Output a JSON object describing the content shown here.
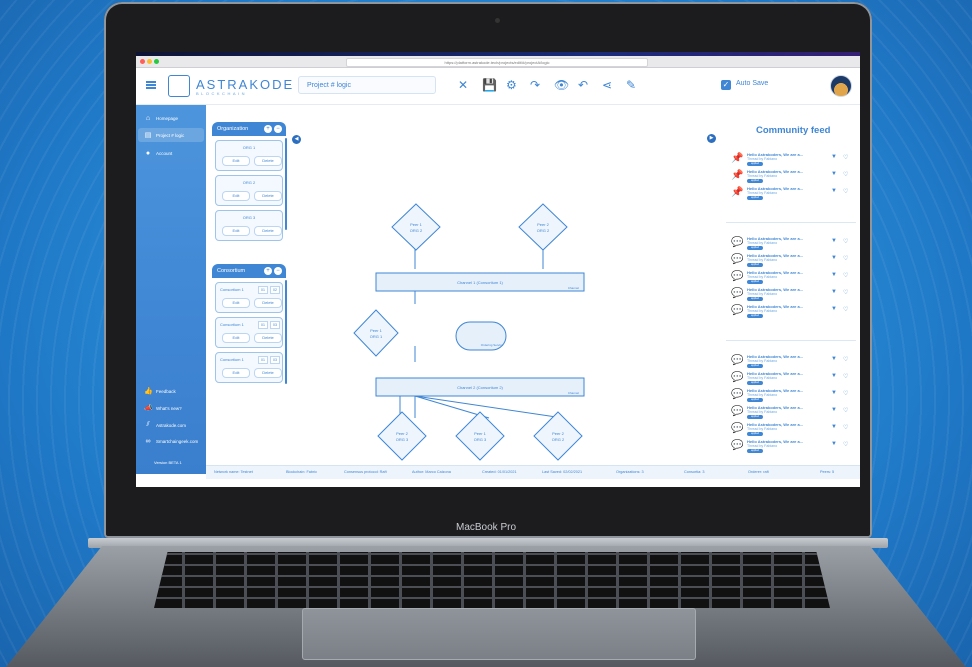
{
  "browser": {
    "url": "https://platform.astrakode.tech/projects/edit/#/projectA/logic"
  },
  "header": {
    "logo_text": "ASTRAKODE",
    "logo_sub": "BLOCKCHAIN",
    "project_name": "Project # logic",
    "autosave_label": "Auto Save",
    "autosave_check": "✓",
    "tools": [
      "✕",
      "💾",
      "⚙",
      "↷",
      "👁",
      "↶",
      "⋖",
      "✎"
    ]
  },
  "sidebar": {
    "items": [
      {
        "icon": "⌂",
        "label": "Homepage"
      },
      {
        "icon": "▤",
        "label": "Project # logic"
      },
      {
        "icon": "●",
        "label": "Account"
      }
    ],
    "bottom_items": [
      {
        "icon": "👍",
        "label": "Feedback"
      },
      {
        "icon": "📣",
        "label": "What's new?"
      },
      {
        "icon": "⫽",
        "label": "Astrakode.com"
      },
      {
        "icon": "∞",
        "label": "Smartchaingeek.com"
      }
    ],
    "version": "Version BETA 1"
  },
  "organization_panel": {
    "title": "Organization",
    "cards": [
      {
        "name": "ORG 1",
        "edit": "Edit",
        "delete": "Delete"
      },
      {
        "name": "ORG 2",
        "edit": "Edit",
        "delete": "Delete"
      },
      {
        "name": "ORG 3",
        "edit": "Edit",
        "delete": "Delete"
      }
    ]
  },
  "consortium_panel": {
    "title": "Consortium",
    "cards": [
      {
        "name": "Consortium 1",
        "a": "01",
        "b": "02",
        "edit": "Edit",
        "delete": "Delete"
      },
      {
        "name": "Consortium 1",
        "a": "01",
        "b": "03",
        "edit": "Edit",
        "delete": "Delete"
      },
      {
        "name": "Consortium 1",
        "a": "01",
        "b": "03",
        "edit": "Edit",
        "delete": "Delete"
      }
    ]
  },
  "canvas": {
    "peer_top_left": [
      "Peer 1",
      "ORG 2"
    ],
    "peer_top_right": [
      "Peer 2",
      "ORG 2"
    ],
    "channel_1": "Channel 1 (Consortium 1)",
    "channel_1_tag": "Channel",
    "peer_mid_left": [
      "Peer 1",
      "ORG 1"
    ],
    "orderer": "Ordering Service",
    "channel_2": "Channel 2 (Consortium 2)",
    "channel_2_tag": "Channel",
    "peer_bottom_1": [
      "Peer 2",
      "ORG 3"
    ],
    "peer_bottom_2": [
      "Peer 1",
      "ORG 3"
    ],
    "peer_bottom_3": [
      "Peer 2",
      "ORG 2"
    ]
  },
  "feed": {
    "title": "Community feed",
    "item_title": "Hello Astrakoders, We are a...",
    "item_sub": "Thread by Fabiano",
    "item_tag": "applied",
    "icons": [
      "📌",
      "📌",
      "📌",
      "💬",
      "💬",
      "💬",
      "💬",
      "💬",
      "💬",
      "💬",
      "💬",
      "💬",
      "💬",
      "💬"
    ]
  },
  "status": {
    "network": "Network name: Testnet",
    "blockchain": "Blockchain: Fabric",
    "consensus": "Consensus protocol: Raft",
    "author": "Author: Marco Calzona",
    "created": "Created: 01/01/2021",
    "last_saved": "Last Saved: 02/02/2021",
    "organizations": "Organizations: 3",
    "consortia": "Consortia: 3",
    "orderer": "Orderer: raft",
    "peers": "Peers: 5"
  },
  "laptop": {
    "label": "MacBook Pro"
  }
}
